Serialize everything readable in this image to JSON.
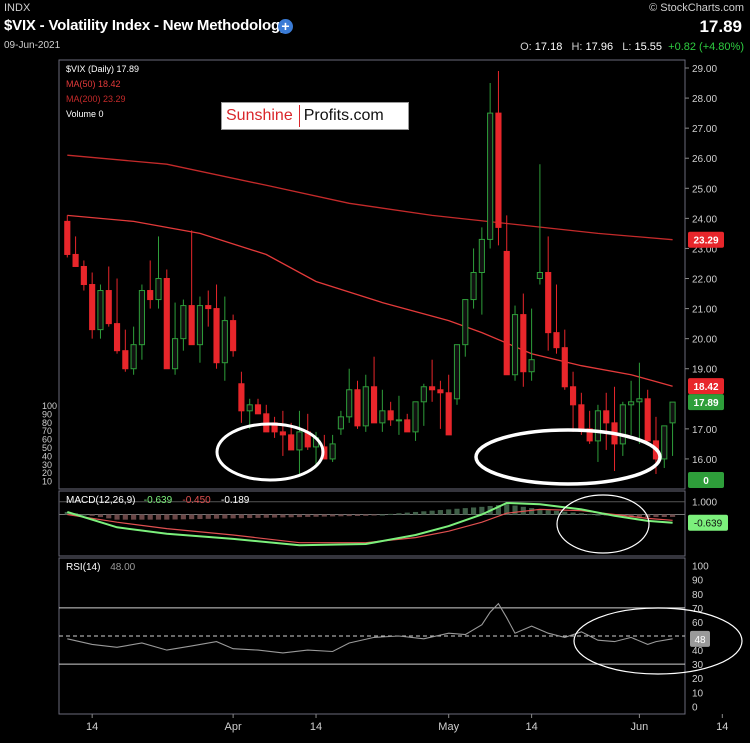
{
  "header": {
    "exchange": "INDX",
    "title": "$VIX - Volatility Index - New Methodology",
    "date": "09-Jun-2021",
    "brand": "© StockCharts.com",
    "last": "17.89",
    "o_label": "O:",
    "o_value": "17.18",
    "h_label": "H:",
    "h_value": "17.96",
    "l_label": "L:",
    "l_value": "15.55",
    "change": "+0.82 (+4.80%)"
  },
  "logo": {
    "part1": "Sunshine",
    "part2": "Profits.com"
  },
  "icons": {
    "add": "plus-circle-icon"
  },
  "colors": {
    "background": "#000000",
    "up": "#2e9e3a",
    "down": "#e8262b",
    "ma50": "#e33a3a",
    "ma200": "#c42a2a",
    "macd": "#7cf07c",
    "signal": "#e05050",
    "rsi": "#9a9a9a"
  },
  "chart_data": [
    {
      "type": "candlestick",
      "title": "$VIX (Daily) 17.89",
      "legend": [
        {
          "label": "$VIX (Daily) 17.89",
          "color": "#ffffff"
        },
        {
          "label": "MA(50) 18.42",
          "color": "#e33a3a"
        },
        {
          "label": "MA(200) 23.29",
          "color": "#c42a2a"
        },
        {
          "label": "Volume 0",
          "color": "#ffffff"
        }
      ],
      "ylim": [
        15.1,
        29.2
      ],
      "yticks": [
        "29.00",
        "28.00",
        "27.00",
        "26.00",
        "25.00",
        "24.00",
        "23.00",
        "22.00",
        "21.00",
        "20.00",
        "19.00",
        "17.00",
        "16.00"
      ],
      "ytick_values": [
        29,
        28,
        27,
        26,
        25,
        24,
        23,
        22,
        21,
        20,
        19,
        17,
        16
      ],
      "volume_ticks": [
        "100",
        "90",
        "80",
        "70",
        "60",
        "50",
        "40",
        "30",
        "20",
        "10"
      ],
      "xticks": [
        "14",
        "Apr",
        "14",
        "May",
        "14",
        "Jun",
        "14"
      ],
      "xtick_index": [
        3,
        20,
        30,
        46,
        56,
        69,
        79
      ],
      "price_tags": [
        {
          "label": "23.29",
          "value": 23.29,
          "color": "#e8262b"
        },
        {
          "label": "18.42",
          "value": 18.42,
          "color": "#e8262b"
        },
        {
          "label": "17.89",
          "value": 17.89,
          "color": "#2e9e3a"
        },
        {
          "label": "0",
          "value": 0,
          "color": "#2e9e3a",
          "pane": "volume"
        }
      ],
      "candles": [
        [
          23.9,
          24.1,
          22.7,
          22.8
        ],
        [
          22.8,
          23.4,
          22.4,
          22.4
        ],
        [
          22.4,
          22.6,
          21.6,
          21.8
        ],
        [
          21.8,
          22.2,
          20.0,
          20.3
        ],
        [
          20.3,
          21.8,
          20.0,
          21.6
        ],
        [
          21.6,
          22.4,
          20.4,
          20.5
        ],
        [
          20.5,
          22.0,
          19.5,
          19.6
        ],
        [
          19.6,
          20.3,
          18.9,
          19.0
        ],
        [
          19.0,
          20.4,
          18.8,
          19.8
        ],
        [
          19.8,
          21.8,
          19.3,
          21.6
        ],
        [
          21.6,
          22.6,
          21.0,
          21.3
        ],
        [
          21.3,
          23.4,
          21.0,
          22.0
        ],
        [
          22.0,
          22.3,
          19.1,
          19.0
        ],
        [
          19.0,
          21.2,
          18.8,
          20.0
        ],
        [
          20.0,
          21.3,
          19.6,
          21.1
        ],
        [
          21.1,
          23.6,
          20.6,
          19.8
        ],
        [
          19.8,
          21.4,
          19.2,
          21.1
        ],
        [
          21.1,
          21.6,
          20.4,
          21.0
        ],
        [
          21.0,
          21.8,
          19.0,
          19.2
        ],
        [
          19.2,
          21.4,
          18.6,
          20.6
        ],
        [
          20.6,
          20.8,
          19.4,
          19.6
        ],
        [
          18.5,
          18.9,
          17.2,
          17.6
        ],
        [
          17.6,
          18.0,
          17.0,
          17.8
        ],
        [
          17.8,
          18.0,
          17.5,
          17.5
        ],
        [
          17.5,
          17.8,
          16.9,
          16.9
        ],
        [
          17.2,
          17.4,
          16.7,
          16.9
        ],
        [
          16.9,
          17.6,
          16.1,
          16.8
        ],
        [
          16.8,
          17.2,
          16.3,
          16.3
        ],
        [
          16.3,
          17.6,
          15.5,
          16.9
        ],
        [
          16.9,
          17.5,
          16.3,
          16.4
        ],
        [
          16.4,
          16.9,
          15.7,
          16.7
        ],
        [
          16.4,
          16.8,
          16.0,
          16.0
        ],
        [
          16.0,
          16.8,
          15.9,
          16.5
        ],
        [
          17.0,
          17.6,
          16.8,
          17.4
        ],
        [
          17.4,
          19.0,
          17.2,
          18.3
        ],
        [
          18.3,
          18.6,
          17.0,
          17.1
        ],
        [
          17.1,
          18.8,
          16.9,
          18.4
        ],
        [
          18.4,
          19.4,
          18.0,
          17.2
        ],
        [
          17.2,
          18.3,
          16.9,
          17.6
        ],
        [
          17.6,
          17.9,
          17.1,
          17.3
        ],
        [
          17.3,
          18.1,
          16.8,
          17.3
        ],
        [
          17.3,
          17.5,
          16.9,
          16.9
        ],
        [
          16.9,
          17.8,
          16.6,
          17.9
        ],
        [
          17.9,
          18.5,
          17.1,
          18.4
        ],
        [
          18.4,
          19.3,
          17.9,
          18.3
        ],
        [
          18.3,
          18.6,
          17.0,
          18.2
        ],
        [
          18.2,
          18.8,
          16.8,
          16.8
        ],
        [
          18.0,
          19.6,
          17.8,
          19.8
        ],
        [
          19.8,
          21.2,
          19.4,
          21.3
        ],
        [
          21.3,
          23.0,
          21.0,
          22.2
        ],
        [
          22.2,
          23.7,
          20.8,
          23.3
        ],
        [
          23.3,
          28.5,
          23.0,
          27.5
        ],
        [
          27.5,
          28.9,
          23.1,
          23.7
        ],
        [
          22.9,
          24.1,
          18.9,
          18.8
        ],
        [
          18.8,
          21.1,
          18.6,
          20.8
        ],
        [
          20.8,
          21.5,
          18.4,
          18.9
        ],
        [
          18.9,
          21.0,
          18.6,
          19.3
        ],
        [
          22.0,
          25.8,
          21.8,
          22.2
        ],
        [
          22.2,
          23.4,
          19.6,
          20.2
        ],
        [
          20.2,
          21.8,
          19.5,
          19.7
        ],
        [
          19.7,
          20.3,
          18.3,
          18.4
        ],
        [
          18.4,
          18.9,
          16.9,
          17.8
        ],
        [
          17.8,
          18.2,
          16.8,
          17.0
        ],
        [
          17.0,
          17.6,
          16.5,
          16.6
        ],
        [
          16.6,
          17.8,
          15.9,
          17.6
        ],
        [
          17.6,
          18.2,
          16.3,
          17.2
        ],
        [
          17.2,
          18.4,
          15.6,
          16.5
        ],
        [
          16.5,
          17.9,
          16.1,
          17.8
        ],
        [
          17.8,
          18.6,
          16.8,
          17.9
        ],
        [
          17.9,
          19.2,
          16.5,
          18.0
        ],
        [
          18.0,
          18.3,
          16.9,
          16.6
        ],
        [
          16.6,
          17.4,
          15.5,
          16.0
        ],
        [
          16.0,
          16.9,
          15.7,
          17.1
        ],
        [
          17.2,
          17.5,
          16.1,
          17.89
        ]
      ],
      "ma50": [
        [
          0,
          24.1
        ],
        [
          8,
          23.9
        ],
        [
          16,
          23.5
        ],
        [
          24,
          22.8
        ],
        [
          30,
          21.9
        ],
        [
          38,
          21.2
        ],
        [
          46,
          20.6
        ],
        [
          50,
          20.2
        ],
        [
          56,
          19.5
        ],
        [
          62,
          19.1
        ],
        [
          68,
          18.8
        ],
        [
          73,
          18.42
        ]
      ],
      "ma200": [
        [
          0,
          26.1
        ],
        [
          12,
          25.8
        ],
        [
          24,
          25.1
        ],
        [
          34,
          24.5
        ],
        [
          44,
          24.1
        ],
        [
          54,
          23.8
        ],
        [
          64,
          23.5
        ],
        [
          73,
          23.29
        ]
      ]
    },
    {
      "type": "line",
      "title": "MACD(12,26,9) -0.639, -0.450, -0.189",
      "legend": [
        {
          "label": "MACD(12,26,9)",
          "color": "#ffffff"
        },
        {
          "label": "-0.639",
          "color": "#7cf07c"
        },
        {
          "label": "-0.450",
          "color": "#e05050"
        },
        {
          "label": "-0.189",
          "color": "#ffffff"
        }
      ],
      "ylim": [
        -3.0,
        1.6
      ],
      "yticks": [
        "1.000"
      ],
      "ytick_values": [
        1.0
      ],
      "zero_line": 0,
      "tag": {
        "label": "-0.639",
        "value": -0.639
      },
      "series": [
        {
          "name": "MACD",
          "points": [
            [
              0,
              0.2
            ],
            [
              6,
              -1.0
            ],
            [
              12,
              -1.5
            ],
            [
              20,
              -1.9
            ],
            [
              28,
              -2.4
            ],
            [
              36,
              -2.3
            ],
            [
              42,
              -1.6
            ],
            [
              46,
              -0.9
            ],
            [
              50,
              0.0
            ],
            [
              53,
              0.9
            ],
            [
              57,
              0.8
            ],
            [
              62,
              0.4
            ],
            [
              66,
              -0.1
            ],
            [
              70,
              -0.5
            ],
            [
              73,
              -0.64
            ]
          ]
        },
        {
          "name": "Signal",
          "points": [
            [
              0,
              0.0
            ],
            [
              6,
              -0.6
            ],
            [
              12,
              -1.1
            ],
            [
              20,
              -1.6
            ],
            [
              28,
              -2.2
            ],
            [
              36,
              -2.2
            ],
            [
              42,
              -1.8
            ],
            [
              46,
              -1.3
            ],
            [
              50,
              -0.6
            ],
            [
              53,
              0.1
            ],
            [
              57,
              0.4
            ],
            [
              62,
              0.3
            ],
            [
              66,
              0.0
            ],
            [
              70,
              -0.3
            ],
            [
              73,
              -0.45
            ]
          ]
        }
      ]
    },
    {
      "type": "line",
      "title": "RSI(14) 48.00",
      "legend": [
        {
          "label": "RSI(14)",
          "color": "#ffffff"
        },
        {
          "label": "48.00",
          "color": "#9a9a9a"
        }
      ],
      "ylim": [
        -4,
        104
      ],
      "yticks": [
        "100",
        "90",
        "80",
        "70",
        "60",
        "50",
        "40",
        "30",
        "20",
        "10",
        "0"
      ],
      "ytick_values": [
        100,
        90,
        80,
        70,
        60,
        50,
        40,
        30,
        20,
        10,
        0
      ],
      "levels": [
        70,
        50,
        30
      ],
      "tag": {
        "label": "48",
        "value": 48
      },
      "series": [
        {
          "name": "RSI",
          "points": [
            [
              0,
              48
            ],
            [
              3,
              44
            ],
            [
              6,
              42
            ],
            [
              9,
              45
            ],
            [
              12,
              40
            ],
            [
              15,
              43
            ],
            [
              18,
              46
            ],
            [
              20,
              41
            ],
            [
              23,
              40
            ],
            [
              26,
              38
            ],
            [
              29,
              40
            ],
            [
              32,
              39
            ],
            [
              34,
              45
            ],
            [
              37,
              49
            ],
            [
              40,
              50
            ],
            [
              43,
              48
            ],
            [
              46,
              52
            ],
            [
              48,
              51
            ],
            [
              50,
              58
            ],
            [
              51,
              67
            ],
            [
              52,
              73
            ],
            [
              53,
              63
            ],
            [
              54,
              52
            ],
            [
              56,
              57
            ],
            [
              58,
              52
            ],
            [
              60,
              49
            ],
            [
              62,
              53
            ],
            [
              64,
              47
            ],
            [
              66,
              46
            ],
            [
              68,
              49
            ],
            [
              70,
              44
            ],
            [
              71,
              46
            ],
            [
              73,
              48
            ]
          ]
        }
      ]
    }
  ]
}
